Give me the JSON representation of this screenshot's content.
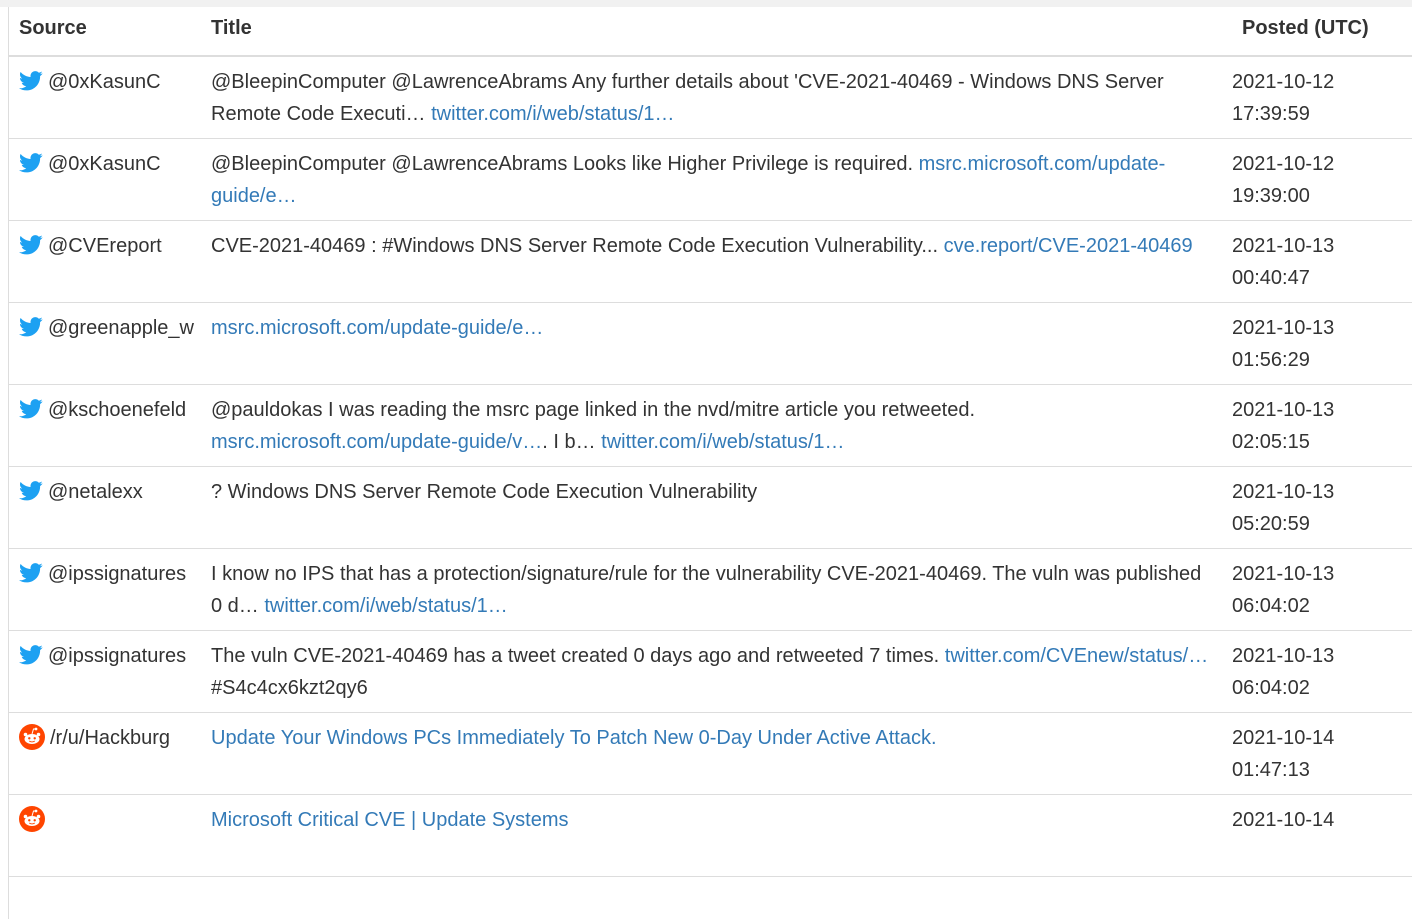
{
  "headers": {
    "source": "Source",
    "title": "Title",
    "posted": "Posted (UTC)"
  },
  "colors": {
    "link": "#337ab7",
    "twitter": "#1da1f2",
    "reddit": "#ff4500",
    "border": "#dddddd"
  },
  "rows": [
    {
      "icon": "twitter-bird-icon",
      "source": "@0xKasunC",
      "text1": "@BleepinComputer @LawrenceAbrams Any further details about 'CVE-2021-40469 - Windows DNS Server Remote Code Executi… ",
      "link1": "twitter.com/i/web/status/1…",
      "text2": "",
      "link2": "",
      "date": "2021-10-12",
      "time": "17:39:59"
    },
    {
      "icon": "twitter-bird-icon",
      "source": "@0xKasunC",
      "text1": "@BleepinComputer @LawrenceAbrams Looks like Higher Privilege is required. ",
      "link1": "msrc.microsoft.com/update-guide/e…",
      "text2": "",
      "link2": "",
      "date": "2021-10-12",
      "time": "19:39:00"
    },
    {
      "icon": "twitter-bird-icon",
      "source": "@CVEreport",
      "text1": "CVE-2021-40469 : #Windows DNS Server Remote Code Execution Vulnerability... ",
      "link1": "cve.report/CVE-2021-40469",
      "text2": "",
      "link2": "",
      "date": "2021-10-13",
      "time": "00:40:47"
    },
    {
      "icon": "twitter-bird-icon",
      "source": "@greenapple_w",
      "text1": "",
      "link1": "msrc.microsoft.com/update-guide/e…",
      "text2": "",
      "link2": "",
      "date": "2021-10-13",
      "time": "01:56:29"
    },
    {
      "icon": "twitter-bird-icon",
      "source": "@kschoenefeld",
      "text1": "@pauldokas I was reading the msrc page linked in the nvd/mitre article you retweeted. ",
      "link1": "msrc.microsoft.com/update-guide/v…",
      "text2": ". I b… ",
      "link2": "twitter.com/i/web/status/1…",
      "date": "2021-10-13",
      "time": "02:05:15"
    },
    {
      "icon": "twitter-bird-icon",
      "source": "@netalexx",
      "text1": "? Windows DNS Server Remote Code Execution Vulnerability",
      "link1": "",
      "text2": "",
      "link2": "",
      "date": "2021-10-13",
      "time": "05:20:59"
    },
    {
      "icon": "twitter-bird-icon",
      "source": "@ipssignatures",
      "text1": "I know no IPS that has a protection/signature/rule for the vulnerability CVE-2021-40469. The vuln was published 0 d… ",
      "link1": "twitter.com/i/web/status/1…",
      "text2": "",
      "link2": "",
      "date": "2021-10-13",
      "time": "06:04:02"
    },
    {
      "icon": "twitter-bird-icon",
      "source": "@ipssignatures",
      "text1": "The vuln CVE-2021-40469 has a tweet created 0 days ago and retweeted 7 times. ",
      "link1": "twitter.com/CVEnew/status/…",
      "text2": " #S4c4cx6kzt2qy6",
      "link2": "",
      "date": "2021-10-13",
      "time": "06:04:02"
    },
    {
      "icon": "reddit-icon",
      "source": "/r/u/Hackburg",
      "text1": "",
      "link1": "Update Your Windows PCs Immediately To Patch New 0-Day Under Active Attack.",
      "text2": "",
      "link2": "",
      "date": "2021-10-14",
      "time": "01:47:13"
    },
    {
      "icon": "reddit-icon",
      "source": "",
      "text1": "",
      "link1": "Microsoft Critical CVE | Update Systems",
      "text2": "",
      "link2": "",
      "date": "2021-10-14",
      "time": ""
    }
  ]
}
